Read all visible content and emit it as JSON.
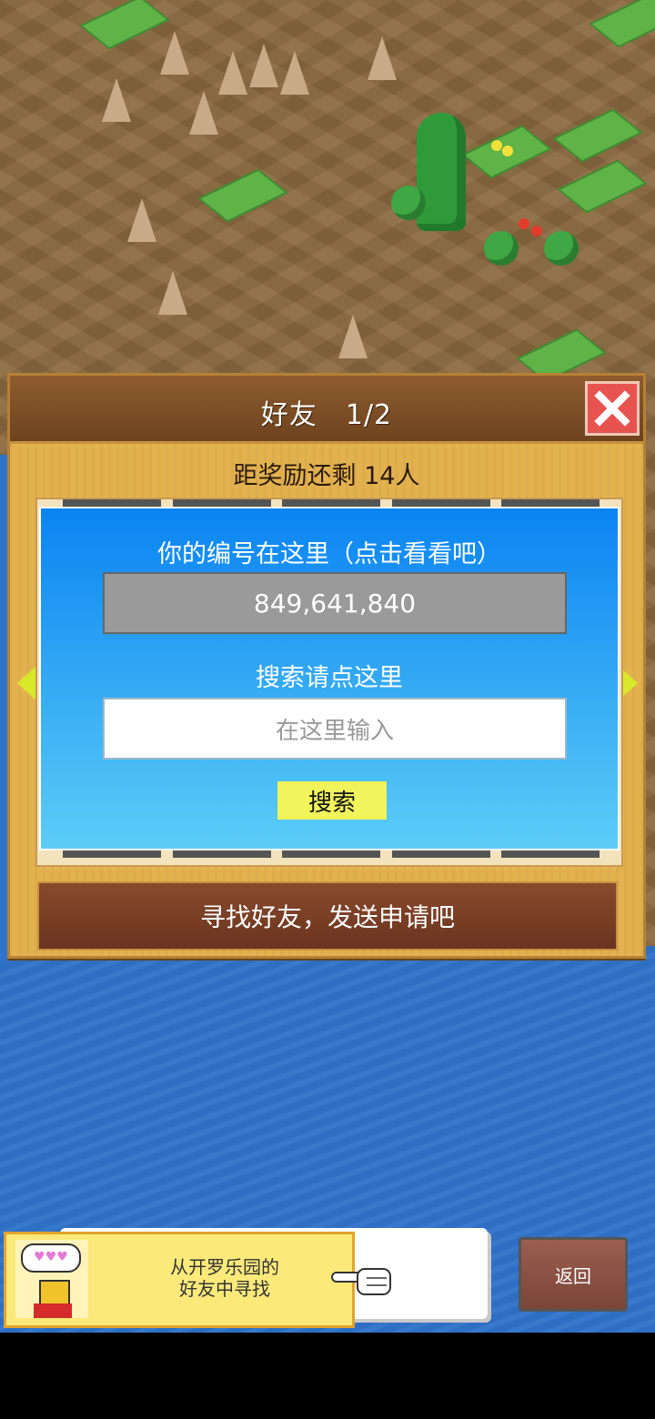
{
  "dialog": {
    "title": "好友　1/2",
    "reward_text": "距奖励还剩 14人",
    "code_label": "你的编号在这里（点击看看吧）",
    "code_value": "849,641,840",
    "search_label": "搜索请点这里",
    "search_placeholder": "在这里输入",
    "search_button": "搜索",
    "find_button": "寻找好友，发送申请吧"
  },
  "bottom": {
    "kairo_line1": "从开罗乐园的",
    "kairo_line2": "好友中寻找",
    "bubble_hearts": "♥♥♥",
    "back_button": "返回"
  },
  "colors": {
    "close_red": "#e7544f",
    "panel_blue_top": "#0a84f2",
    "panel_blue_bottom": "#5ccdf7",
    "search_yellow": "#f1f45a",
    "dialog_gold": "#e3b24f"
  },
  "icons": [
    "close-icon",
    "arrow-left-icon",
    "arrow-right-icon",
    "pointing-hand-icon",
    "hearts-icon"
  ]
}
